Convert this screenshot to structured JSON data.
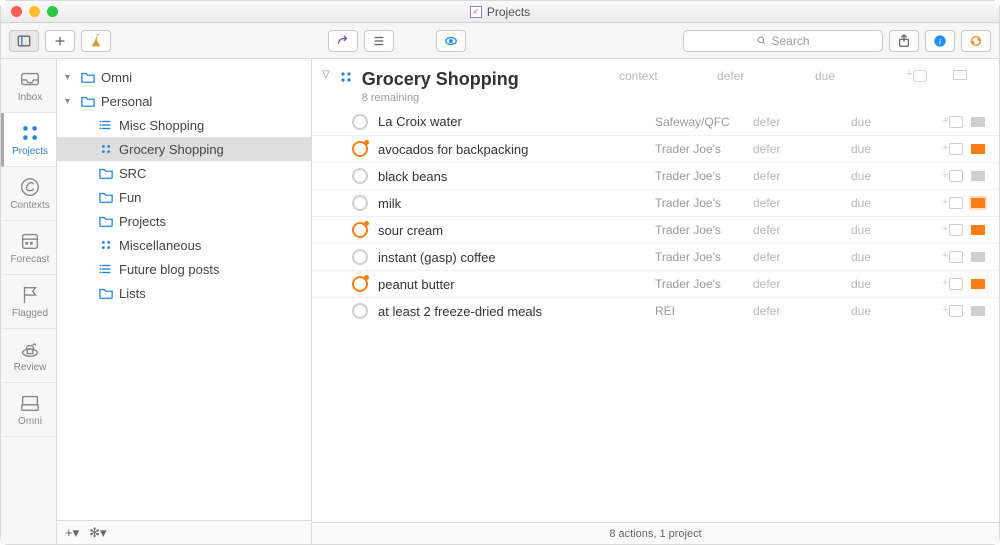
{
  "window": {
    "title": "Projects"
  },
  "toolbar": {
    "search_placeholder": "Search"
  },
  "rail": [
    {
      "id": "inbox",
      "label": "Inbox",
      "stripe": "#9aa0a6"
    },
    {
      "id": "projects",
      "label": "Projects",
      "stripe": "#2a82d6",
      "active": true
    },
    {
      "id": "contexts",
      "label": "Contexts",
      "stripe": "#b0b0b0"
    },
    {
      "id": "forecast",
      "label": "Forecast",
      "stripe": "#e06a6a"
    },
    {
      "id": "flagged",
      "label": "Flagged",
      "stripe": "#e8b65a"
    },
    {
      "id": "review",
      "label": "Review",
      "stripe": "#c9a35e"
    },
    {
      "id": "omni",
      "label": "Omni",
      "stripe": "#7a7a7a"
    }
  ],
  "tree": [
    {
      "depth": 0,
      "kind": "folder-open",
      "name": "Omni",
      "chev": "▾"
    },
    {
      "depth": 0,
      "kind": "folder-open",
      "name": "Personal",
      "chev": "▾"
    },
    {
      "depth": 1,
      "kind": "single",
      "name": "Misc Shopping"
    },
    {
      "depth": 1,
      "kind": "parallel",
      "name": "Grocery Shopping",
      "selected": true
    },
    {
      "depth": 1,
      "kind": "folder",
      "name": "SRC"
    },
    {
      "depth": 1,
      "kind": "folder",
      "name": "Fun"
    },
    {
      "depth": 1,
      "kind": "folder",
      "name": "Projects"
    },
    {
      "depth": 1,
      "kind": "parallel",
      "name": "Miscellaneous"
    },
    {
      "depth": 1,
      "kind": "single",
      "name": "Future blog posts"
    },
    {
      "depth": 1,
      "kind": "folder",
      "name": "Lists"
    }
  ],
  "project": {
    "title": "Grocery Shopping",
    "subtitle": "8 remaining",
    "column_headers": {
      "context": "context",
      "defer": "defer",
      "due": "due"
    }
  },
  "tasks": [
    {
      "title": "La Croix water",
      "context": "Safeway/QFC",
      "defer": "defer",
      "due": "due",
      "flagged": false
    },
    {
      "title": "avocados for backpacking",
      "context": "Trader Joe's",
      "defer": "defer",
      "due": "due",
      "flagged": true
    },
    {
      "title": "black beans",
      "context": "Trader Joe's",
      "defer": "defer",
      "due": "due",
      "flagged": false
    },
    {
      "title": "milk",
      "context": "Trader Joe's",
      "defer": "defer",
      "due": "due",
      "flagged": false,
      "flag_selected": true
    },
    {
      "title": "sour cream",
      "context": "Trader Joe's",
      "defer": "defer",
      "due": "due",
      "flagged": true
    },
    {
      "title": "instant (gasp) coffee",
      "context": "Trader Joe's",
      "defer": "defer",
      "due": "due",
      "flagged": false
    },
    {
      "title": "peanut butter",
      "context": "Trader Joe's",
      "defer": "defer",
      "due": "due",
      "flagged": true
    },
    {
      "title": "at least 2 freeze-dried meals",
      "context": "REI",
      "defer": "defer",
      "due": "due",
      "flagged": false
    }
  ],
  "statusbar": {
    "text": "8 actions, 1 project"
  },
  "outline_footer": {
    "add": "+",
    "gear": "✻"
  }
}
